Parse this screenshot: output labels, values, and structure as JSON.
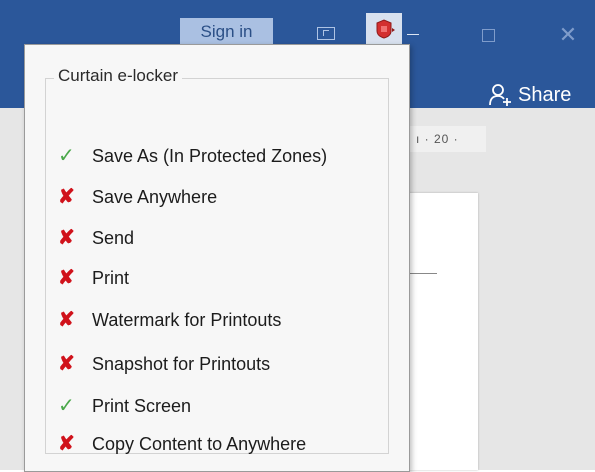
{
  "titlebar": {
    "signin_label": "Sign in",
    "accent_color": "#2b579a",
    "icons": [
      "ribbon-display-icon",
      "curtain-locker-icon",
      "minimize-icon",
      "maximize-icon",
      "close-icon"
    ],
    "close_glyph": "✕",
    "share_label": "Share"
  },
  "ruler": {
    "marks": "ı · 20 ·"
  },
  "popup": {
    "group_title": "Curtain e-locker",
    "items": [
      {
        "label": "Save As (In Protected Zones)",
        "status": "allowed",
        "glyph": "✓"
      },
      {
        "label": "Save Anywhere",
        "status": "denied",
        "glyph": "✘"
      },
      {
        "label": "Send",
        "status": "denied",
        "glyph": "✘"
      },
      {
        "label": "Print",
        "status": "denied",
        "glyph": "✘"
      },
      {
        "label": "Watermark for Printouts",
        "status": "denied",
        "glyph": "✘"
      },
      {
        "label": "Snapshot for Printouts",
        "status": "denied",
        "glyph": "✘"
      },
      {
        "label": "Print Screen",
        "status": "allowed",
        "glyph": "✓"
      },
      {
        "label": "Copy Content to Anywhere",
        "status": "denied",
        "glyph": "✘"
      }
    ],
    "status_colors": {
      "allowed": "#4aa84a",
      "denied": "#d0121b"
    }
  }
}
